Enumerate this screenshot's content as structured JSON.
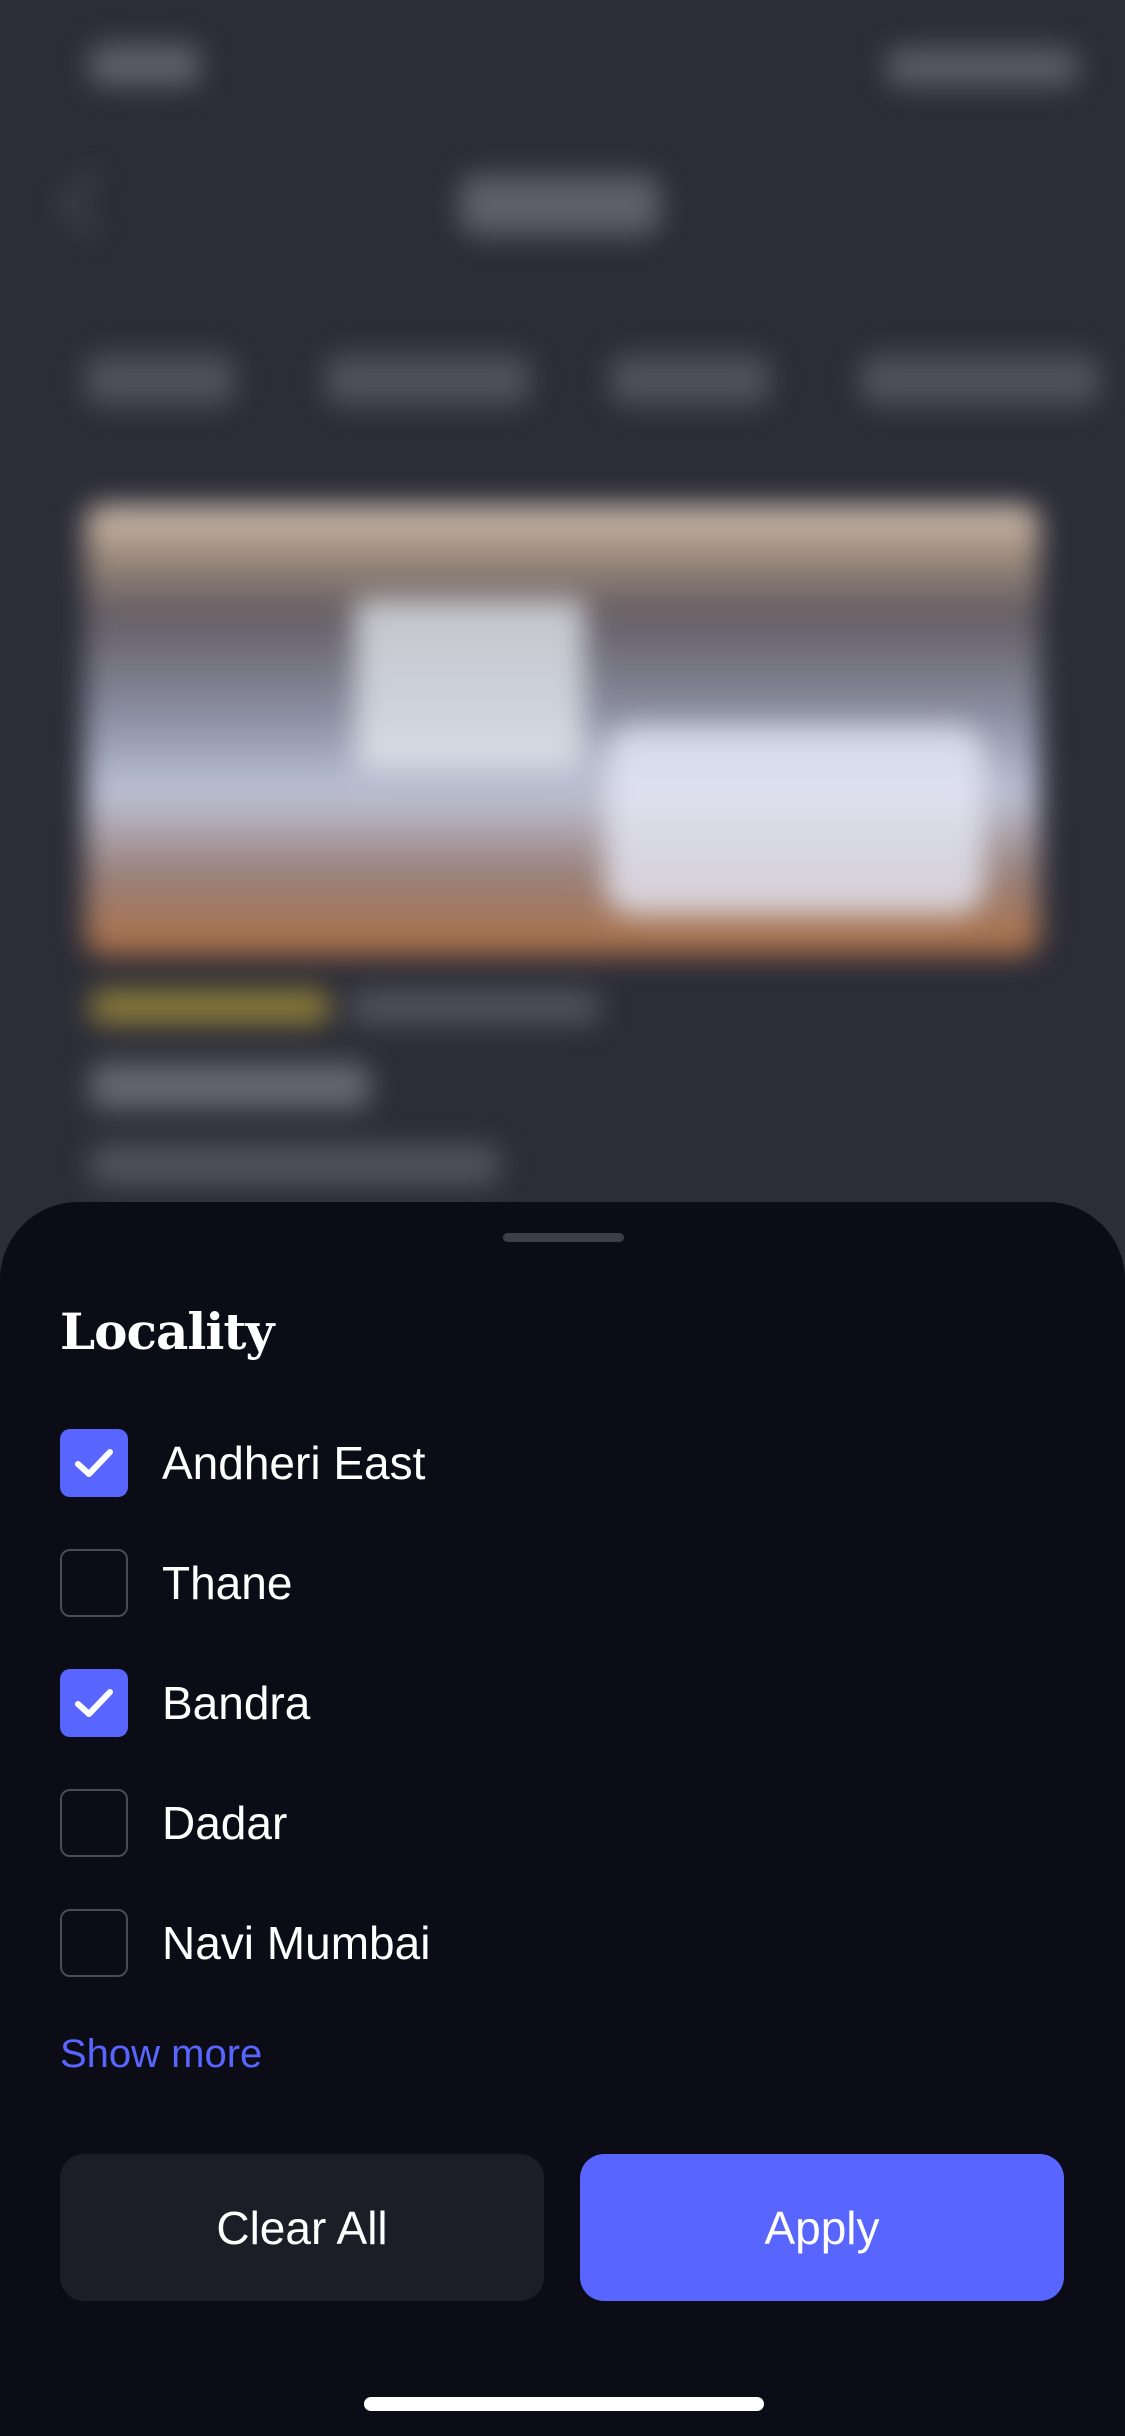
{
  "sheet": {
    "title": "Locality",
    "options": [
      {
        "label": "Andheri East",
        "checked": true
      },
      {
        "label": "Thane",
        "checked": false
      },
      {
        "label": "Bandra",
        "checked": true
      },
      {
        "label": "Dadar",
        "checked": false
      },
      {
        "label": "Navi Mumbai",
        "checked": false
      }
    ],
    "show_more_label": "Show more",
    "clear_label": "Clear All",
    "apply_label": "Apply"
  },
  "colors": {
    "accent": "#5865ff",
    "sheet_bg": "#0b0c15",
    "secondary_button_bg": "#1c1d26"
  },
  "icons": {
    "checkbox_checked": "checkmark-icon"
  }
}
